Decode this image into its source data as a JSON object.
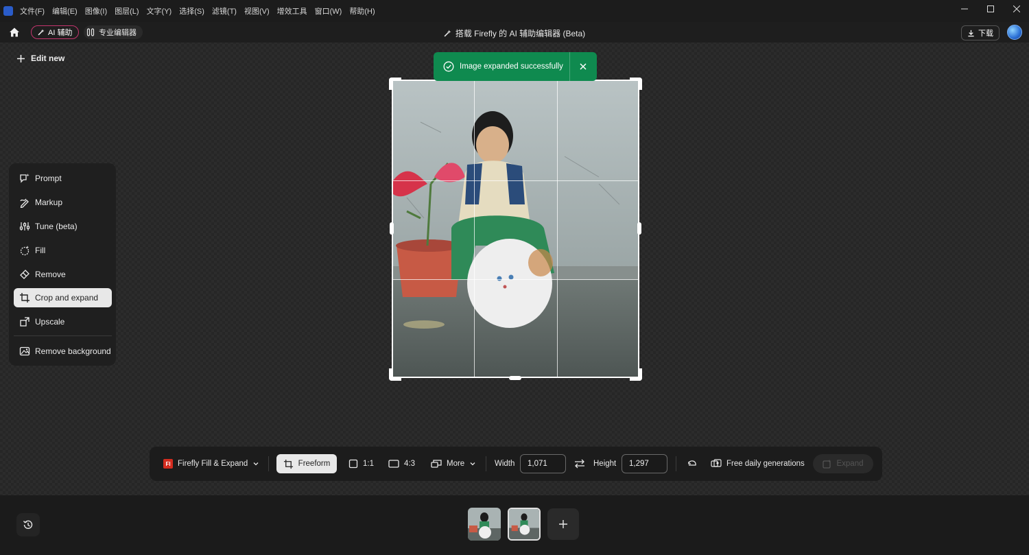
{
  "menubar": {
    "items": [
      "文件(F)",
      "编辑(E)",
      "图像(I)",
      "图层(L)",
      "文字(Y)",
      "选择(S)",
      "滤镜(T)",
      "视图(V)",
      "增效工具",
      "窗口(W)",
      "帮助(H)"
    ]
  },
  "titlebar": {
    "ai_mode_label": "AI 辅助",
    "pro_mode_label": "专业编辑器",
    "title": "搭载 Firefly 的 AI 辅助编辑器 (Beta)",
    "download_label": "下载"
  },
  "edit_new_label": "Edit new",
  "tools": [
    {
      "label": "Prompt",
      "icon": "prompt-icon"
    },
    {
      "label": "Markup",
      "icon": "markup-icon"
    },
    {
      "label": "Tune (beta)",
      "icon": "tune-icon"
    },
    {
      "label": "Fill",
      "icon": "fill-icon"
    },
    {
      "label": "Remove",
      "icon": "remove-icon"
    },
    {
      "label": "Crop and expand",
      "icon": "crop-icon",
      "active": true
    },
    {
      "label": "Upscale",
      "icon": "upscale-icon"
    },
    {
      "label": "Remove background",
      "icon": "remove-background-icon"
    }
  ],
  "toast": {
    "message": "Image expanded successfully",
    "color": "#0f8a4f"
  },
  "toolbar": {
    "model_label": "Firefly Fill & Expand",
    "model_logo": "Fl",
    "freeform_label": "Freeform",
    "ratio_1_1": "1:1",
    "ratio_4_3": "4:3",
    "more_label": "More",
    "width_label": "Width",
    "width_value": "1,071",
    "height_label": "Height",
    "height_value": "1,297",
    "generations_label": "Free daily generations",
    "expand_label": "Expand"
  },
  "colors": {
    "accent_pink": "#c5356e",
    "toast_green": "#0f8a4f"
  }
}
